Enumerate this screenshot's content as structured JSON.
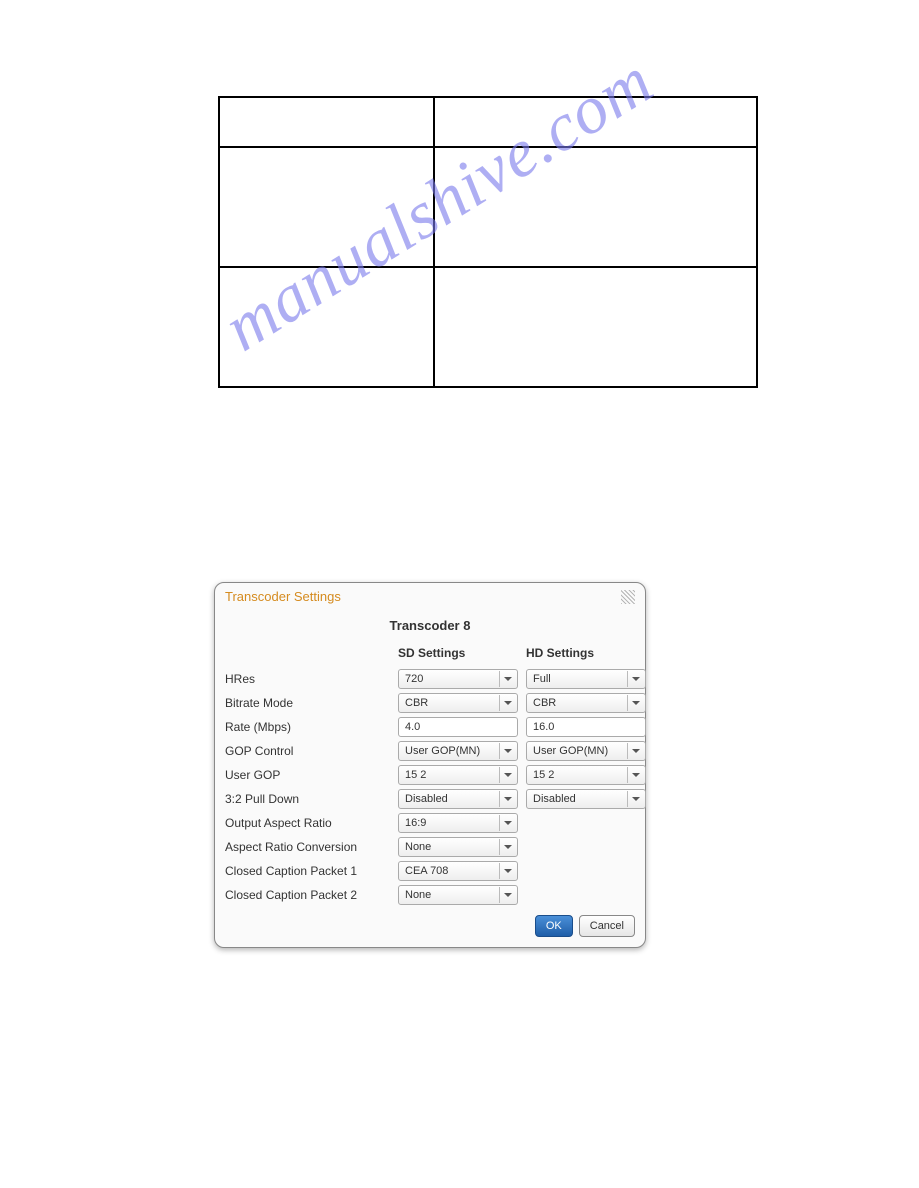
{
  "watermark": "manualshive.com",
  "dialog": {
    "title": "Transcoder Settings",
    "subtitle": "Transcoder 8",
    "columns": {
      "sd": "SD Settings",
      "hd": "HD Settings"
    },
    "rows": {
      "hres": {
        "label": "HRes",
        "sd": "720",
        "hd": "Full"
      },
      "bitrateMode": {
        "label": "Bitrate Mode",
        "sd": "CBR",
        "hd": "CBR"
      },
      "rate": {
        "label": "Rate (Mbps)",
        "sd": "4.0",
        "hd": "16.0"
      },
      "gopControl": {
        "label": "GOP Control",
        "sd": "User GOP(MN)",
        "hd": "User GOP(MN)"
      },
      "userGop": {
        "label": "User GOP",
        "sd": "15 2",
        "hd": "15 2"
      },
      "pulldown": {
        "label": "3:2 Pull Down",
        "sd": "Disabled",
        "hd": "Disabled"
      },
      "outAspect": {
        "label": "Output Aspect Ratio",
        "sd": "16:9"
      },
      "aspectConv": {
        "label": "Aspect Ratio Conversion",
        "sd": "None"
      },
      "cc1": {
        "label": "Closed Caption Packet 1",
        "sd": "CEA 708"
      },
      "cc2": {
        "label": "Closed Caption Packet 2",
        "sd": "None"
      }
    },
    "buttons": {
      "ok": "OK",
      "cancel": "Cancel"
    }
  }
}
